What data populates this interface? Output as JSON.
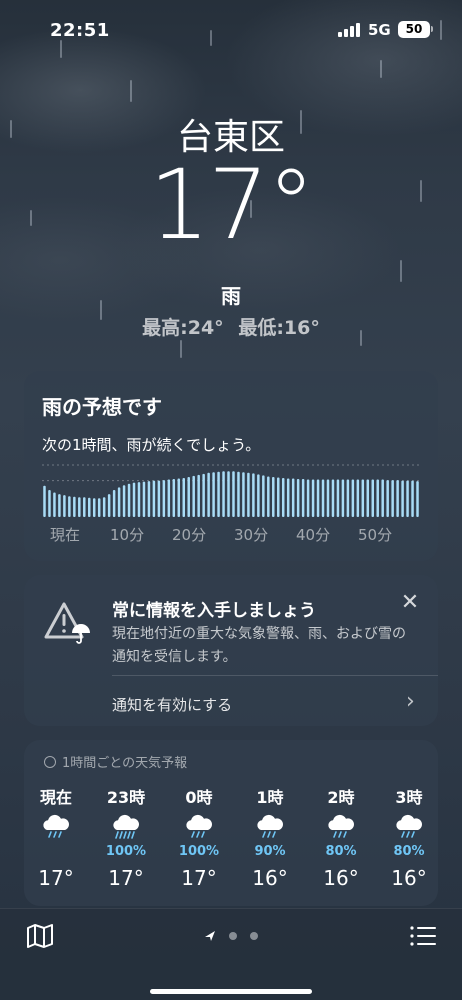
{
  "status_bar": {
    "time": "22:51",
    "network": "5G",
    "battery": "50"
  },
  "header": {
    "location": "台東区",
    "temperature": "17°",
    "condition": "雨",
    "high": "最高:24°",
    "low": "最低:16°"
  },
  "rain_card": {
    "title": "雨の予想です",
    "description": "次の1時間、雨が続くでしょう。",
    "ticks": [
      "現在",
      "10分",
      "20分",
      "30分",
      "40分",
      "50分"
    ]
  },
  "chart_data": {
    "type": "bar",
    "xlabel": "",
    "ylabel": "",
    "categories": [
      "現在",
      "10分",
      "20分",
      "30分",
      "40分",
      "50分"
    ],
    "values": [
      0.6,
      0.52,
      0.47,
      0.44,
      0.42,
      0.4,
      0.39,
      0.38,
      0.38,
      0.37,
      0.36,
      0.36,
      0.38,
      0.44,
      0.52,
      0.57,
      0.61,
      0.64,
      0.66,
      0.67,
      0.68,
      0.69,
      0.7,
      0.7,
      0.71,
      0.72,
      0.73,
      0.74,
      0.75,
      0.77,
      0.79,
      0.81,
      0.83,
      0.85,
      0.86,
      0.87,
      0.88,
      0.88,
      0.88,
      0.87,
      0.86,
      0.85,
      0.84,
      0.82,
      0.8,
      0.78,
      0.77,
      0.76,
      0.75,
      0.74,
      0.74,
      0.73,
      0.73,
      0.72,
      0.72,
      0.72,
      0.72,
      0.72,
      0.72,
      0.72,
      0.72,
      0.72,
      0.72,
      0.72,
      0.72,
      0.72,
      0.72,
      0.72,
      0.72,
      0.71,
      0.71,
      0.71,
      0.7,
      0.7,
      0.7,
      0.69
    ],
    "ylim": [
      0,
      1
    ],
    "grid": true
  },
  "alert_card": {
    "title": "常に情報を入手しましょう",
    "body": "現在地付近の重大な気象警報、雨、および雪の通知を受信します。",
    "link": "通知を有効にする",
    "close": "✕",
    "chevron": "›"
  },
  "hourly": {
    "header": "1時間ごとの天気予報",
    "items": [
      {
        "hour": "現在",
        "icon": "cloud-rain-icon",
        "pct": "",
        "temp": "17°"
      },
      {
        "hour": "23時",
        "icon": "cloud-rain-heavy-icon",
        "pct": "100%",
        "temp": "17°"
      },
      {
        "hour": "0時",
        "icon": "cloud-rain-icon",
        "pct": "100%",
        "temp": "17°"
      },
      {
        "hour": "1時",
        "icon": "cloud-rain-icon",
        "pct": "90%",
        "temp": "16°"
      },
      {
        "hour": "2時",
        "icon": "cloud-rain-icon",
        "pct": "80%",
        "temp": "16°"
      },
      {
        "hour": "3時",
        "icon": "cloud-rain-icon",
        "pct": "80%",
        "temp": "16°"
      }
    ]
  },
  "colors": {
    "bar": "#a9dcf6",
    "precip": "#6fc6f5"
  }
}
